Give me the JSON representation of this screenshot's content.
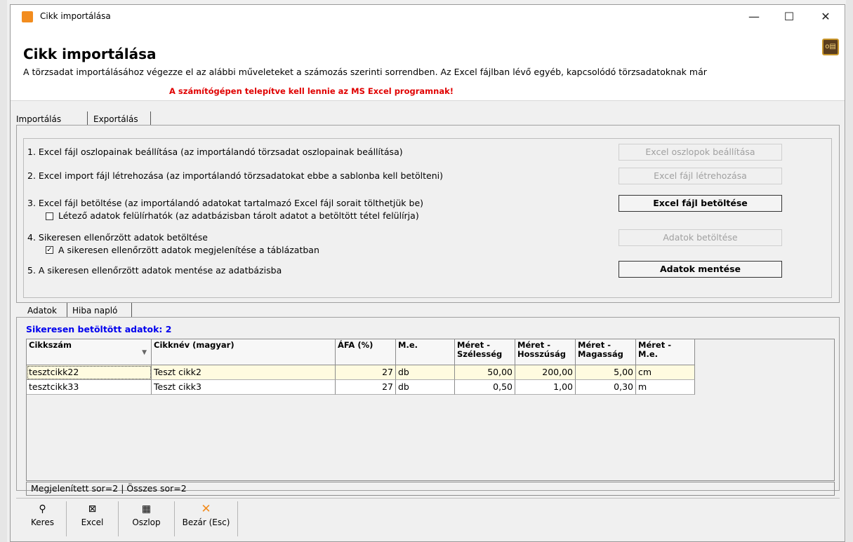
{
  "window": {
    "title": "Cikk importálása",
    "minimize": "—",
    "maximize": "☐",
    "close": "✕"
  },
  "header": {
    "title": "Cikk importálása",
    "description": "A törzsadat importálásához végezze el az alábbi műveleteket a számozás szerinti sorrendben. Az Excel fájlban lévő egyéb, kapcsolódó törzsadatoknak már",
    "warning": "A számítógépen telepítve kell lennie az MS Excel programnak!"
  },
  "tabs": [
    "Importálás",
    "Exportálás"
  ],
  "steps": {
    "s1": "1. Excel fájl oszlopainak beállítása (az importálandó törzsadat oszlopainak beállítása)",
    "s2": "2. Excel import fájl létrehozása (az importálandó törzsadatokat ebbe a sablonba kell betölteni)",
    "s3": "3. Excel fájl betöltése (az importálandó adatokat tartalmazó Excel fájl sorait tölthetjük be)",
    "s3_check": "Létező adatok felülírhatók (az adatbázisban tárolt adatot a betöltött tétel felülírja)",
    "s4": "4. Sikeresen ellenőrzött adatok betöltése",
    "s4_check": "A sikeresen ellenőrzött adatok megjelenítése a táblázatban",
    "s5": "5. A sikeresen ellenőrzött adatok mentése az adatbázisba",
    "s3_checked": false,
    "s4_checked": true
  },
  "buttons": {
    "b1": "Excel oszlopok beállítása",
    "b2": "Excel fájl létrehozása",
    "b3": "Excel fájl betöltése",
    "b4": "Adatok betöltése",
    "b5": "Adatok mentése"
  },
  "data_tabs": [
    "Adatok",
    "Hiba napló"
  ],
  "loaded_label": "Sikeresen betöltött adatok: 2",
  "table": {
    "headers": [
      "Cikkszám",
      "Cikknév (magyar)",
      "ÁFA (%)",
      "M.e.",
      "Méret - Szélesség",
      "Méret - Hosszúság",
      "Méret - Magasság",
      "Méret - M.e."
    ],
    "rows": [
      [
        "tesztcikk22",
        "Teszt cikk2",
        "27",
        "db",
        "50,00",
        "200,00",
        "5,00",
        "cm"
      ],
      [
        "tesztcikk33",
        "Teszt cikk3",
        "27",
        "db",
        "0,50",
        "1,00",
        "0,30",
        "m"
      ]
    ]
  },
  "status": "Megjelenített sor=2 | Összes sor=2",
  "toolbar": [
    {
      "label": "Keres",
      "icon": "search-icon"
    },
    {
      "label": "Excel",
      "icon": "excel-icon"
    },
    {
      "label": "Oszlop",
      "icon": "columns-icon"
    },
    {
      "label": "Bezár (Esc)",
      "icon": "close-icon"
    }
  ],
  "colors": {
    "warning": "#e00000",
    "loaded_label": "#0000ee",
    "selected_row": "#fffbe0",
    "close_icon": "#f28c1e"
  }
}
